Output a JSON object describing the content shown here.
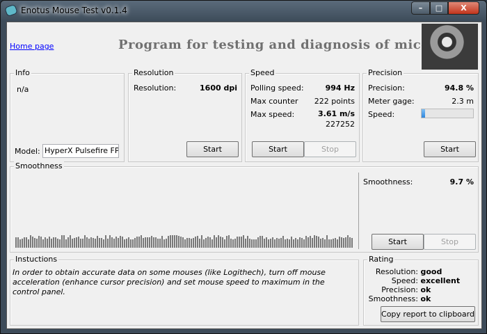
{
  "window": {
    "title": "Enotus Mouse Test v0.1.4",
    "minimize": "–",
    "maximize": "□",
    "close": "X"
  },
  "header": {
    "home_link": "Home page",
    "banner": "Program for testing and diagnosis of mice"
  },
  "info": {
    "legend": "Info",
    "status": "n/a",
    "model_label": "Model:",
    "model_value": "HyperX Pulsefire FPS"
  },
  "resolution": {
    "legend": "Resolution",
    "label": "Resolution:",
    "value": "1600 dpi",
    "start": "Start"
  },
  "speed": {
    "legend": "Speed",
    "polling_label": "Polling speed:",
    "polling_value": "994 Hz",
    "counter_label": "Max counter",
    "counter_value": "222 points",
    "max_label": "Max  speed:",
    "max_value": "3.61 m/s",
    "max_sub": "227252",
    "start": "Start",
    "stop": "Stop"
  },
  "precision": {
    "legend": "Precision",
    "label": "Precision:",
    "value": "94.8 %",
    "gage_label": "Meter gage:",
    "gage_value": "2.3 m",
    "speed_label": "Speed:",
    "speed_level": 0.07,
    "start": "Start"
  },
  "smoothness": {
    "legend": "Smoothness",
    "label": "Smoothness:",
    "value": "9.7 %",
    "start": "Start",
    "stop": "Stop"
  },
  "instructions": {
    "legend": "Instuctions",
    "text": "In order to obtain accurate data on some mouses (like Logithech), turn off mouse acceleration (enhance cursor precision) and set mouse speed to maximum in the control panel."
  },
  "rating": {
    "legend": "Rating",
    "items": [
      {
        "label": "Resolution:",
        "value": "good"
      },
      {
        "label": "Speed:",
        "value": "excellent"
      },
      {
        "label": "Precision:",
        "value": "ok"
      },
      {
        "label": "Smoothness:",
        "value": "ok"
      }
    ],
    "copy": "Copy report to clipboard"
  },
  "colors": {
    "link": "#0000ff",
    "banner": "#707070",
    "progress": "#3c8fe0"
  }
}
